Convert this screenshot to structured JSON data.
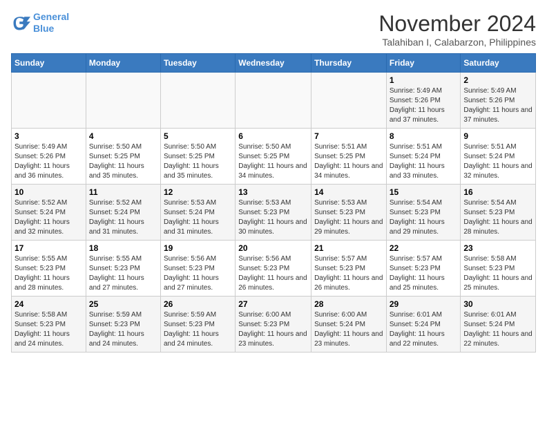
{
  "header": {
    "logo_line1": "General",
    "logo_line2": "Blue",
    "month_year": "November 2024",
    "location": "Talahiban I, Calabarzon, Philippines"
  },
  "weekdays": [
    "Sunday",
    "Monday",
    "Tuesday",
    "Wednesday",
    "Thursday",
    "Friday",
    "Saturday"
  ],
  "weeks": [
    [
      {
        "day": "",
        "info": ""
      },
      {
        "day": "",
        "info": ""
      },
      {
        "day": "",
        "info": ""
      },
      {
        "day": "",
        "info": ""
      },
      {
        "day": "",
        "info": ""
      },
      {
        "day": "1",
        "info": "Sunrise: 5:49 AM\nSunset: 5:26 PM\nDaylight: 11 hours and 37 minutes."
      },
      {
        "day": "2",
        "info": "Sunrise: 5:49 AM\nSunset: 5:26 PM\nDaylight: 11 hours and 37 minutes."
      }
    ],
    [
      {
        "day": "3",
        "info": "Sunrise: 5:49 AM\nSunset: 5:26 PM\nDaylight: 11 hours and 36 minutes."
      },
      {
        "day": "4",
        "info": "Sunrise: 5:50 AM\nSunset: 5:25 PM\nDaylight: 11 hours and 35 minutes."
      },
      {
        "day": "5",
        "info": "Sunrise: 5:50 AM\nSunset: 5:25 PM\nDaylight: 11 hours and 35 minutes."
      },
      {
        "day": "6",
        "info": "Sunrise: 5:50 AM\nSunset: 5:25 PM\nDaylight: 11 hours and 34 minutes."
      },
      {
        "day": "7",
        "info": "Sunrise: 5:51 AM\nSunset: 5:25 PM\nDaylight: 11 hours and 34 minutes."
      },
      {
        "day": "8",
        "info": "Sunrise: 5:51 AM\nSunset: 5:24 PM\nDaylight: 11 hours and 33 minutes."
      },
      {
        "day": "9",
        "info": "Sunrise: 5:51 AM\nSunset: 5:24 PM\nDaylight: 11 hours and 32 minutes."
      }
    ],
    [
      {
        "day": "10",
        "info": "Sunrise: 5:52 AM\nSunset: 5:24 PM\nDaylight: 11 hours and 32 minutes."
      },
      {
        "day": "11",
        "info": "Sunrise: 5:52 AM\nSunset: 5:24 PM\nDaylight: 11 hours and 31 minutes."
      },
      {
        "day": "12",
        "info": "Sunrise: 5:53 AM\nSunset: 5:24 PM\nDaylight: 11 hours and 31 minutes."
      },
      {
        "day": "13",
        "info": "Sunrise: 5:53 AM\nSunset: 5:23 PM\nDaylight: 11 hours and 30 minutes."
      },
      {
        "day": "14",
        "info": "Sunrise: 5:53 AM\nSunset: 5:23 PM\nDaylight: 11 hours and 29 minutes."
      },
      {
        "day": "15",
        "info": "Sunrise: 5:54 AM\nSunset: 5:23 PM\nDaylight: 11 hours and 29 minutes."
      },
      {
        "day": "16",
        "info": "Sunrise: 5:54 AM\nSunset: 5:23 PM\nDaylight: 11 hours and 28 minutes."
      }
    ],
    [
      {
        "day": "17",
        "info": "Sunrise: 5:55 AM\nSunset: 5:23 PM\nDaylight: 11 hours and 28 minutes."
      },
      {
        "day": "18",
        "info": "Sunrise: 5:55 AM\nSunset: 5:23 PM\nDaylight: 11 hours and 27 minutes."
      },
      {
        "day": "19",
        "info": "Sunrise: 5:56 AM\nSunset: 5:23 PM\nDaylight: 11 hours and 27 minutes."
      },
      {
        "day": "20",
        "info": "Sunrise: 5:56 AM\nSunset: 5:23 PM\nDaylight: 11 hours and 26 minutes."
      },
      {
        "day": "21",
        "info": "Sunrise: 5:57 AM\nSunset: 5:23 PM\nDaylight: 11 hours and 26 minutes."
      },
      {
        "day": "22",
        "info": "Sunrise: 5:57 AM\nSunset: 5:23 PM\nDaylight: 11 hours and 25 minutes."
      },
      {
        "day": "23",
        "info": "Sunrise: 5:58 AM\nSunset: 5:23 PM\nDaylight: 11 hours and 25 minutes."
      }
    ],
    [
      {
        "day": "24",
        "info": "Sunrise: 5:58 AM\nSunset: 5:23 PM\nDaylight: 11 hours and 24 minutes."
      },
      {
        "day": "25",
        "info": "Sunrise: 5:59 AM\nSunset: 5:23 PM\nDaylight: 11 hours and 24 minutes."
      },
      {
        "day": "26",
        "info": "Sunrise: 5:59 AM\nSunset: 5:23 PM\nDaylight: 11 hours and 24 minutes."
      },
      {
        "day": "27",
        "info": "Sunrise: 6:00 AM\nSunset: 5:23 PM\nDaylight: 11 hours and 23 minutes."
      },
      {
        "day": "28",
        "info": "Sunrise: 6:00 AM\nSunset: 5:24 PM\nDaylight: 11 hours and 23 minutes."
      },
      {
        "day": "29",
        "info": "Sunrise: 6:01 AM\nSunset: 5:24 PM\nDaylight: 11 hours and 22 minutes."
      },
      {
        "day": "30",
        "info": "Sunrise: 6:01 AM\nSunset: 5:24 PM\nDaylight: 11 hours and 22 minutes."
      }
    ]
  ]
}
